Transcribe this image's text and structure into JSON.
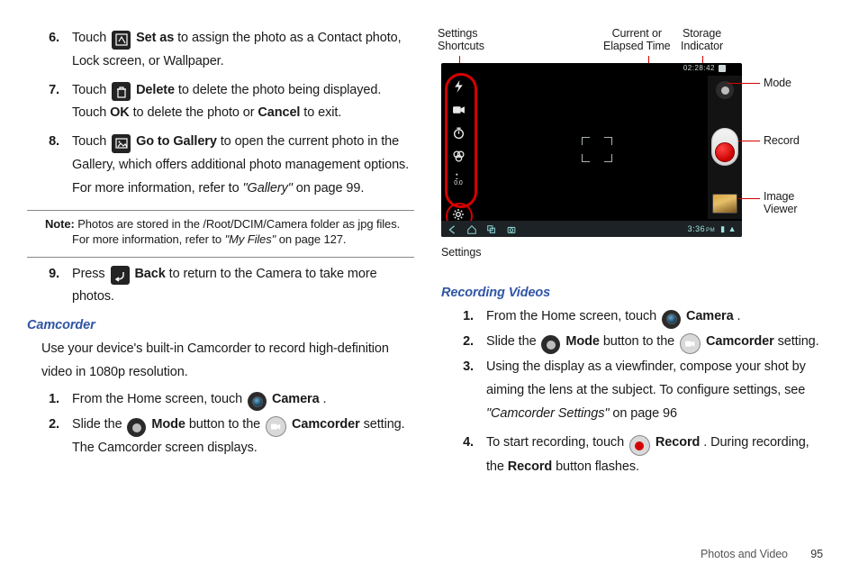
{
  "left": {
    "steps_a": [
      {
        "n": "6.",
        "pre": "Touch ",
        "icon": "setas",
        "bold": "Set as",
        "post": " to assign the photo as a Contact photo, Lock screen, or Wallpaper."
      },
      {
        "n": "7.",
        "pre": "Touch ",
        "icon": "trash",
        "bold": "Delete",
        "post": " to delete the photo being displayed. Touch ",
        "bold2": "OK",
        "post2": " to delete the photo or ",
        "bold3": "Cancel",
        "post3": " to exit."
      },
      {
        "n": "8.",
        "pre": "Touch ",
        "icon": "gallery",
        "bold": "Go to Gallery",
        "post": " to open the current photo in the Gallery, which offers additional photo management options. For more information, refer to ",
        "ital": "\"Gallery\"",
        "post2": "  on page 99."
      }
    ],
    "note_label": "Note:",
    "note_body_a": "Photos are stored in the /Root/DCIM/Camera folder as jpg files. For more information, refer to ",
    "note_ital": "\"My Files\"",
    "note_body_b": "  on page 127.",
    "step9": {
      "n": "9.",
      "pre": "Press ",
      "icon": "back",
      "bold": "Back",
      "post": " to return to the Camera to take more photos."
    },
    "h_camcorder": "Camcorder",
    "camcorder_intro": "Use your device's built-in Camcorder to record high-definition video in 1080p resolution.",
    "cam_steps": [
      {
        "n": "1.",
        "pre": "From the Home screen, touch ",
        "icon": "camera",
        "bold": "Camera",
        "post": "."
      },
      {
        "n": "2.",
        "pre": "Slide the ",
        "icon": "mode-off",
        "bold": "Mode",
        "mid": " button to the ",
        "icon2": "mode-rec",
        "bold2": "Camcorder",
        "post": " setting."
      }
    ],
    "cam_tail": "The Camcorder screen displays."
  },
  "right": {
    "callouts": {
      "settings_shortcuts": "Settings\nShortcuts",
      "current_time": "Current or\nElapsed Time",
      "storage": "Storage\nIndicator",
      "settings": "Settings",
      "mode": "Mode",
      "record": "Record",
      "image_viewer": "Image\nViewer"
    },
    "shot": {
      "time_indicator": "02:28:42",
      "ev_label": "0.0",
      "bottom_time": "3:36",
      "bottom_ampm": "PM"
    },
    "h_recording": "Recording Videos",
    "rec_steps": [
      {
        "n": "1.",
        "pre": "From the Home screen, touch ",
        "icon": "camera",
        "bold": "Camera",
        "post": "."
      },
      {
        "n": "2.",
        "pre": "Slide the ",
        "icon": "mode-off",
        "bold": "Mode",
        "mid": " button to the ",
        "icon2": "mode-rec",
        "bold2": "Camcorder",
        "post": " setting."
      },
      {
        "n": "3.",
        "text": "Using the display as a viewfinder, compose your shot by aiming the lens at the subject. To configure settings, see ",
        "ital": "\"Camcorder Settings\"",
        "post": " on page 96"
      },
      {
        "n": "4.",
        "pre": "To start recording, touch ",
        "icon": "record",
        "bold": "Record",
        "mid": ". During recording, the ",
        "bold2": "Record",
        "post": " button flashes."
      }
    ]
  },
  "footer": {
    "section": "Photos and Video",
    "page": "95"
  }
}
